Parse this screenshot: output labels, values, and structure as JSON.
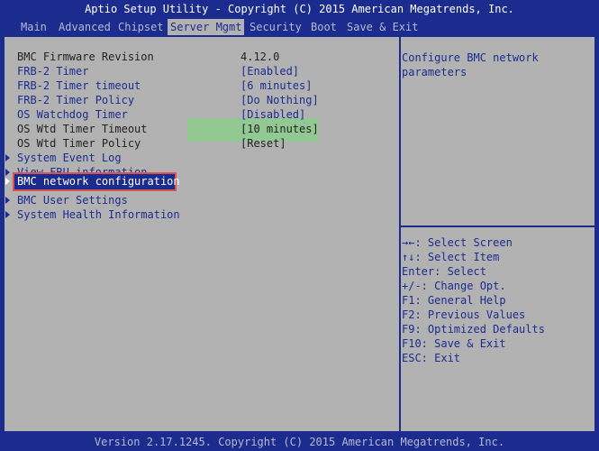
{
  "title": "Aptio Setup Utility - Copyright (C) 2015 American Megatrends, Inc.",
  "tabs": [
    {
      "label": "Main"
    },
    {
      "label": "Advanced"
    },
    {
      "label": "Chipset"
    },
    {
      "label": "Server Mgmt"
    },
    {
      "label": "Security"
    },
    {
      "label": "Boot"
    },
    {
      "label": "Save & Exit"
    }
  ],
  "active_tab": "Server Mgmt",
  "settings": {
    "bmc_fw": {
      "label": "BMC Firmware Revision",
      "value": "4.12.0"
    },
    "frb2_timer": {
      "label": "FRB-2 Timer",
      "value": "[Enabled]"
    },
    "frb2_timeout": {
      "label": "FRB-2 Timer timeout",
      "value": "[6 minutes]"
    },
    "frb2_policy": {
      "label": "FRB-2 Timer Policy",
      "value": "[Do Nothing]"
    },
    "os_wtd_timer": {
      "label": "OS Watchdog Timer",
      "value": "[Disabled]"
    },
    "os_wtd_timeout": {
      "label": "OS Wtd Timer Timeout",
      "value": "[10 minutes]"
    },
    "os_wtd_policy": {
      "label": "OS Wtd Timer Policy",
      "value": "[Reset]"
    }
  },
  "submenus": {
    "system_event_log": "System Event Log",
    "view_fru": "View FRU information",
    "bmc_network": "BMC network configuration",
    "bmc_user": "BMC User Settings",
    "system_health": "System Health Information"
  },
  "help_text": {
    "line1": "Configure BMC network",
    "line2": "parameters"
  },
  "key_help": [
    "→←: Select Screen",
    "↑↓: Select Item",
    "Enter: Select",
    "+/-: Change Opt.",
    "F1: General Help",
    "F2: Previous Values",
    "F9: Optimized Defaults",
    "F10: Save & Exit",
    "ESC: Exit"
  ],
  "footer": "Version 2.17.1245. Copyright (C) 2015 American Megatrends, Inc.",
  "colors": {
    "background_blue": "#1b2c8e",
    "panel_gray": "#b2b2b2",
    "selection_outline": "#d9534f"
  }
}
